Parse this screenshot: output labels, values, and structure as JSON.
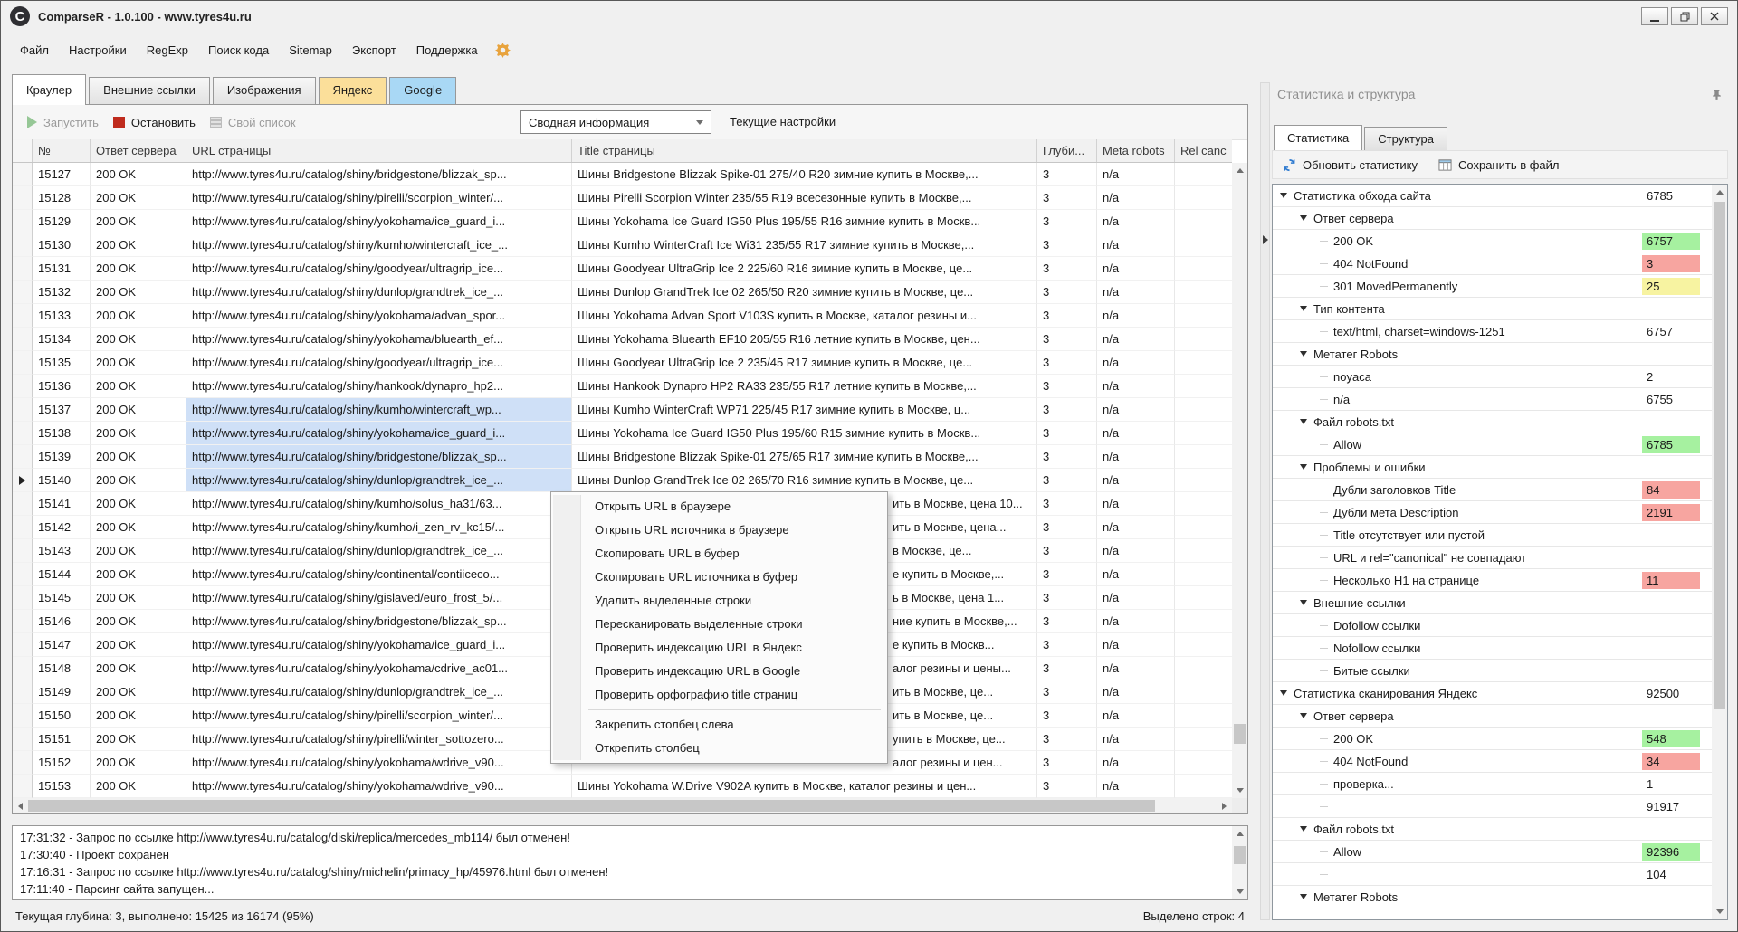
{
  "window": {
    "title": "ComparseR - 1.0.100 - www.tyres4u.ru",
    "logo_letter": "C"
  },
  "menu": {
    "items": [
      {
        "name": "file",
        "label": "Файл"
      },
      {
        "name": "settings",
        "label": "Настройки"
      },
      {
        "name": "regexp",
        "label": "RegExp"
      },
      {
        "name": "code-search",
        "label": "Поиск кода"
      },
      {
        "name": "sitemap",
        "label": "Sitemap"
      },
      {
        "name": "export",
        "label": "Экспорт"
      },
      {
        "name": "support",
        "label": "Поддержка"
      }
    ]
  },
  "tabs": [
    {
      "name": "crawler",
      "label": "Краулер",
      "active": true
    },
    {
      "name": "external-links",
      "label": "Внешние ссылки"
    },
    {
      "name": "images",
      "label": "Изображения"
    },
    {
      "name": "yandex",
      "label": "Яндекс",
      "color": "#fbdf9a"
    },
    {
      "name": "google",
      "label": "Google",
      "color": "#a9d8f5"
    }
  ],
  "toolbar": {
    "start_label": "Запустить",
    "stop_label": "Остановить",
    "custom_list_label": "Свой список",
    "view_select_value": "Сводная информация",
    "settings_label": "Текущие настройки"
  },
  "table": {
    "headers": [
      "№",
      "Ответ сервера",
      "URL страницы",
      "Title страницы",
      "Глуби...",
      "Meta robots",
      "Rel canc"
    ],
    "rows": [
      {
        "num": "15127",
        "status": "200 OK",
        "url": "http://www.tyres4u.ru/catalog/shiny/bridgestone/blizzak_sp...",
        "title": "Шины Bridgestone Blizzak Spike-01 275/40 R20 зимние купить в Москве,...",
        "depth": "3",
        "meta": "n/a"
      },
      {
        "num": "15128",
        "status": "200 OK",
        "url": "http://www.tyres4u.ru/catalog/shiny/pirelli/scorpion_winter/...",
        "title": "Шины Pirelli Scorpion Winter 235/55 R19 всесезонные купить в Москве,...",
        "depth": "3",
        "meta": "n/a"
      },
      {
        "num": "15129",
        "status": "200 OK",
        "url": "http://www.tyres4u.ru/catalog/shiny/yokohama/ice_guard_i...",
        "title": "Шины Yokohama Ice Guard IG50 Plus 195/55 R16 зимние купить в Москв...",
        "depth": "3",
        "meta": "n/a"
      },
      {
        "num": "15130",
        "status": "200 OK",
        "url": "http://www.tyres4u.ru/catalog/shiny/kumho/wintercraft_ice_...",
        "title": "Шины Kumho WinterCraft Ice Wi31 235/55 R17 зимние купить в Москве,...",
        "depth": "3",
        "meta": "n/a"
      },
      {
        "num": "15131",
        "status": "200 OK",
        "url": "http://www.tyres4u.ru/catalog/shiny/goodyear/ultragrip_ice...",
        "title": "Шины Goodyear UltraGrip Ice 2 225/60 R16 зимние купить в Москве, це...",
        "depth": "3",
        "meta": "n/a"
      },
      {
        "num": "15132",
        "status": "200 OK",
        "url": "http://www.tyres4u.ru/catalog/shiny/dunlop/grandtrek_ice_...",
        "title": "Шины Dunlop GrandTrek Ice 02 265/50 R20 зимние купить в Москве, це...",
        "depth": "3",
        "meta": "n/a"
      },
      {
        "num": "15133",
        "status": "200 OK",
        "url": "http://www.tyres4u.ru/catalog/shiny/yokohama/advan_spor...",
        "title": "Шины Yokohama Advan Sport V103S купить в Москве, каталог резины и...",
        "depth": "3",
        "meta": "n/a"
      },
      {
        "num": "15134",
        "status": "200 OK",
        "url": "http://www.tyres4u.ru/catalog/shiny/yokohama/bluearth_ef...",
        "title": "Шины Yokohama Bluearth EF10 205/55 R16 летние купить в Москве, цен...",
        "depth": "3",
        "meta": "n/a"
      },
      {
        "num": "15135",
        "status": "200 OK",
        "url": "http://www.tyres4u.ru/catalog/shiny/goodyear/ultragrip_ice...",
        "title": "Шины Goodyear UltraGrip Ice 2 235/45 R17 зимние купить в Москве, це...",
        "depth": "3",
        "meta": "n/a"
      },
      {
        "num": "15136",
        "status": "200 OK",
        "url": "http://www.tyres4u.ru/catalog/shiny/hankook/dynapro_hp2...",
        "title": "Шины Hankook Dynapro HP2 RA33 235/55 R17 летние купить в Москве,...",
        "depth": "3",
        "meta": "n/a"
      },
      {
        "num": "15137",
        "status": "200 OK",
        "url": "http://www.tyres4u.ru/catalog/shiny/kumho/wintercraft_wp...",
        "title": "Шины Kumho WinterCraft WP71 225/45 R17 зимние купить в Москве, ц...",
        "depth": "3",
        "meta": "n/a",
        "selected": true
      },
      {
        "num": "15138",
        "status": "200 OK",
        "url": "http://www.tyres4u.ru/catalog/shiny/yokohama/ice_guard_i...",
        "title": "Шины Yokohama Ice Guard IG50 Plus 195/60 R15 зимние купить в Москв...",
        "depth": "3",
        "meta": "n/a",
        "selected": true
      },
      {
        "num": "15139",
        "status": "200 OK",
        "url": "http://www.tyres4u.ru/catalog/shiny/bridgestone/blizzak_sp...",
        "title": "Шины Bridgestone Blizzak Spike-01 275/65 R17 зимние купить в Москве,...",
        "depth": "3",
        "meta": "n/a",
        "selected": true
      },
      {
        "num": "15140",
        "status": "200 OK",
        "url": "http://www.tyres4u.ru/catalog/shiny/dunlop/grandtrek_ice_...",
        "title": "Шины Dunlop GrandTrek Ice 02 265/70 R16 зимние купить в Москве, це...",
        "depth": "3",
        "meta": "n/a",
        "selected": true,
        "current": true
      },
      {
        "num": "15141",
        "status": "200 OK",
        "url": "http://www.tyres4u.ru/catalog/shiny/kumho/solus_ha31/63...",
        "title": "ить в Москве, цена 10...",
        "depth": "3",
        "meta": "n/a",
        "shifted": true
      },
      {
        "num": "15142",
        "status": "200 OK",
        "url": "http://www.tyres4u.ru/catalog/shiny/kumho/i_zen_rv_kc15/...",
        "title": "ить в Москве, цена...",
        "depth": "3",
        "meta": "n/a",
        "shifted": true
      },
      {
        "num": "15143",
        "status": "200 OK",
        "url": "http://www.tyres4u.ru/catalog/shiny/dunlop/grandtrek_ice_...",
        "title": "в Москве, це...",
        "depth": "3",
        "meta": "n/a",
        "shifted": true
      },
      {
        "num": "15144",
        "status": "200 OK",
        "url": "http://www.tyres4u.ru/catalog/shiny/continental/contiiceco...",
        "title": "е купить в Москве,...",
        "depth": "3",
        "meta": "n/a",
        "shifted": true
      },
      {
        "num": "15145",
        "status": "200 OK",
        "url": "http://www.tyres4u.ru/catalog/shiny/gislaved/euro_frost_5/...",
        "title": "ь в Москве, цена 1...",
        "depth": "3",
        "meta": "n/a",
        "shifted": true
      },
      {
        "num": "15146",
        "status": "200 OK",
        "url": "http://www.tyres4u.ru/catalog/shiny/bridgestone/blizzak_sp...",
        "title": "ние купить в Москве,...",
        "depth": "3",
        "meta": "n/a",
        "shifted": true
      },
      {
        "num": "15147",
        "status": "200 OK",
        "url": "http://www.tyres4u.ru/catalog/shiny/yokohama/ice_guard_i...",
        "title": "е купить в Москв...",
        "depth": "3",
        "meta": "n/a",
        "shifted": true
      },
      {
        "num": "15148",
        "status": "200 OK",
        "url": "http://www.tyres4u.ru/catalog/shiny/yokohama/cdrive_ac01...",
        "title": "алог резины и цены...",
        "depth": "3",
        "meta": "n/a",
        "shifted": true
      },
      {
        "num": "15149",
        "status": "200 OK",
        "url": "http://www.tyres4u.ru/catalog/shiny/dunlop/grandtrek_ice_...",
        "title": "ить в Москве, це...",
        "depth": "3",
        "meta": "n/a",
        "shifted": true
      },
      {
        "num": "15150",
        "status": "200 OK",
        "url": "http://www.tyres4u.ru/catalog/shiny/pirelli/scorpion_winter/...",
        "title": "ить в Москве, це...",
        "depth": "3",
        "meta": "n/a",
        "shifted": true
      },
      {
        "num": "15151",
        "status": "200 OK",
        "url": "http://www.tyres4u.ru/catalog/shiny/pirelli/winter_sottozero...",
        "title": "упить в Москве, це...",
        "depth": "3",
        "meta": "n/a",
        "shifted": true
      },
      {
        "num": "15152",
        "status": "200 OK",
        "url": "http://www.tyres4u.ru/catalog/shiny/yokohama/wdrive_v90...",
        "title": "алог резины и цен...",
        "depth": "3",
        "meta": "n/a",
        "shifted": true
      },
      {
        "num": "15153",
        "status": "200 OK",
        "url": "http://www.tyres4u.ru/catalog/shiny/yokohama/wdrive_v90...",
        "title": "Шины Yokohama W.Drive V902A купить в Москве, каталог резины и цен...",
        "depth": "3",
        "meta": "n/a"
      }
    ]
  },
  "context_menu": {
    "items": [
      {
        "name": "open-url-in-browser",
        "label": "Открыть URL в браузере"
      },
      {
        "name": "open-source-url-in-browser",
        "label": "Открыть URL источника в браузере"
      },
      {
        "name": "copy-url-to-clipboard",
        "label": "Скопировать URL в буфер"
      },
      {
        "name": "copy-source-url-to-clipboard",
        "label": "Скопировать URL источника в буфер"
      },
      {
        "name": "delete-selected-rows",
        "label": "Удалить выделенные строки"
      },
      {
        "name": "rescan-selected-rows",
        "label": "Пересканировать выделенные строки"
      },
      {
        "name": "check-url-index-yandex",
        "label": "Проверить индексацию URL в Яндекс"
      },
      {
        "name": "check-url-index-google",
        "label": "Проверить индексацию URL в Google"
      },
      {
        "name": "check-title-spelling",
        "label": "Проверить орфографию title страниц"
      },
      {
        "separator": true
      },
      {
        "name": "pin-column-left",
        "label": "Закрепить столбец слева"
      },
      {
        "name": "unpin-column",
        "label": "Открепить столбец"
      }
    ]
  },
  "log": {
    "lines": [
      "17:31:32 - Запрос по ссылке http://www.tyres4u.ru/catalog/diski/replica/mercedes_mb114/ был отменен!",
      "17:30:40 - Проект сохранен",
      "17:16:31 - Запрос по ссылке http://www.tyres4u.ru/catalog/shiny/michelin/primacy_hp/45976.html был отменен!",
      "17:11:40 - Парсинг сайта запущен..."
    ]
  },
  "status_bar": {
    "left": "Текущая глубина: 3, выполнено: 15425 из 16174 (95%)",
    "right": "Выделено строк: 4"
  },
  "stats_panel": {
    "title": "Статистика и структура",
    "tabs": [
      {
        "name": "statistics",
        "label": "Статистика",
        "active": true
      },
      {
        "name": "structure",
        "label": "Структура"
      }
    ],
    "refresh_label": "Обновить статистику",
    "save_label": "Сохранить в файл",
    "tree": [
      {
        "level": 0,
        "arrow": true,
        "label": "Статистика обхода сайта",
        "count": "6785"
      },
      {
        "level": 1,
        "arrow": true,
        "label": "Ответ сервера",
        "count": ""
      },
      {
        "level": 2,
        "label": "200 OK",
        "count": "6757",
        "badge": "green"
      },
      {
        "level": 2,
        "label": "404 NotFound",
        "count": "3",
        "badge": "red"
      },
      {
        "level": 2,
        "label": "301 MovedPermanently",
        "count": "25",
        "badge": "yellow"
      },
      {
        "level": 1,
        "arrow": true,
        "label": "Тип контента",
        "count": ""
      },
      {
        "level": 2,
        "label": "text/html, charset=windows-1251",
        "count": "6757"
      },
      {
        "level": 1,
        "arrow": true,
        "label": "Метатег Robots",
        "count": ""
      },
      {
        "level": 2,
        "label": "noyaca",
        "count": "2"
      },
      {
        "level": 2,
        "label": "n/a",
        "count": "6755"
      },
      {
        "level": 1,
        "arrow": true,
        "label": "Файл robots.txt",
        "count": ""
      },
      {
        "level": 2,
        "label": "Allow",
        "count": "6785",
        "badge": "green"
      },
      {
        "level": 1,
        "arrow": true,
        "label": "Проблемы и ошибки",
        "count": ""
      },
      {
        "level": 2,
        "label": "Дубли заголовков Title",
        "count": "84",
        "badge": "red"
      },
      {
        "level": 2,
        "label": "Дубли мета Description",
        "count": "2191",
        "badge": "red"
      },
      {
        "level": 2,
        "label": "Title отсутствует или пустой",
        "count": ""
      },
      {
        "level": 2,
        "label": "URL и rel=\"canonical\" не совпадают",
        "count": ""
      },
      {
        "level": 2,
        "label": "Несколько H1 на странице",
        "count": "11",
        "badge": "red"
      },
      {
        "level": 1,
        "arrow": true,
        "label": "Внешние ссылки",
        "count": ""
      },
      {
        "level": 2,
        "label": "Dofollow ссылки",
        "count": ""
      },
      {
        "level": 2,
        "label": "Nofollow ссылки",
        "count": ""
      },
      {
        "level": 2,
        "label": "Битые ссылки",
        "count": ""
      },
      {
        "level": 0,
        "arrow": true,
        "label": "Статистика сканирования Яндекс",
        "count": "92500"
      },
      {
        "level": 1,
        "arrow": true,
        "label": "Ответ сервера",
        "count": ""
      },
      {
        "level": 2,
        "label": "200 OK",
        "count": "548",
        "badge": "green"
      },
      {
        "level": 2,
        "label": "404 NotFound",
        "count": "34",
        "badge": "red"
      },
      {
        "level": 2,
        "label": "проверка...",
        "count": "1"
      },
      {
        "level": 2,
        "label": "",
        "count": "91917"
      },
      {
        "level": 1,
        "arrow": true,
        "label": "Файл robots.txt",
        "count": ""
      },
      {
        "level": 2,
        "label": "Allow",
        "count": "92396",
        "badge": "green"
      },
      {
        "level": 2,
        "label": "",
        "count": "104"
      },
      {
        "level": 1,
        "arrow": true,
        "label": "Метатег Robots",
        "count": ""
      },
      {
        "level": 2,
        "label": "",
        "count": ""
      }
    ]
  },
  "colors": {
    "selection_blue": "#cfe0f7",
    "badge_green": "#a6f1a0",
    "badge_red": "#f7a5a0",
    "badge_yellow": "#f7f3a1",
    "yandex_tab": "#fbdf9a",
    "google_tab": "#a9d8f5",
    "stop_icon_red": "#bf2b1d",
    "gear_orange": "#e8a33d",
    "refresh_blue": "#2f7bd0"
  },
  "icons": {
    "app_logo": "C-circle",
    "gear": "gear",
    "play": "green-triangle",
    "stop": "red-square",
    "custom_list": "list-sheet",
    "refresh": "circular-arrows",
    "save": "table-grid",
    "pin": "pushpin",
    "current_row": "right-arrow"
  }
}
